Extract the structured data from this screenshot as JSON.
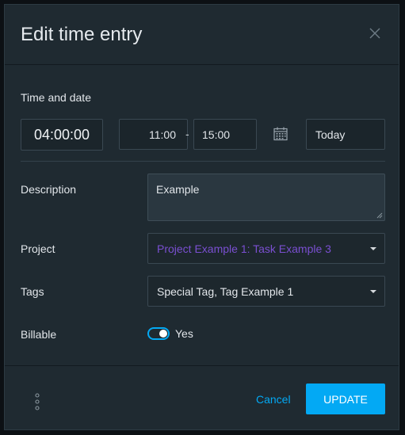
{
  "modal": {
    "title": "Edit time entry",
    "close_icon": "close-icon"
  },
  "time_and_date": {
    "label": "Time and date",
    "duration": "04:00:00",
    "start_time": "11:00",
    "separator": "-",
    "end_time": "15:00",
    "calendar_icon": "calendar-icon",
    "date": "Today"
  },
  "description": {
    "label": "Description",
    "value": "Example"
  },
  "project": {
    "label": "Project",
    "value": "Project Example 1: Task Example 3",
    "color": "#7a4fd1"
  },
  "tags": {
    "label": "Tags",
    "value": "Special Tag, Tag Example 1"
  },
  "billable": {
    "label": "Billable",
    "toggle_label": "Yes",
    "enabled": true
  },
  "footer": {
    "more_icon": "more-vertical-icon",
    "cancel_label": "Cancel",
    "update_label": "UPDATE"
  },
  "colors": {
    "accent": "#03a9f4",
    "modal_bg": "#1f2a31",
    "page_bg": "#0c1014"
  }
}
